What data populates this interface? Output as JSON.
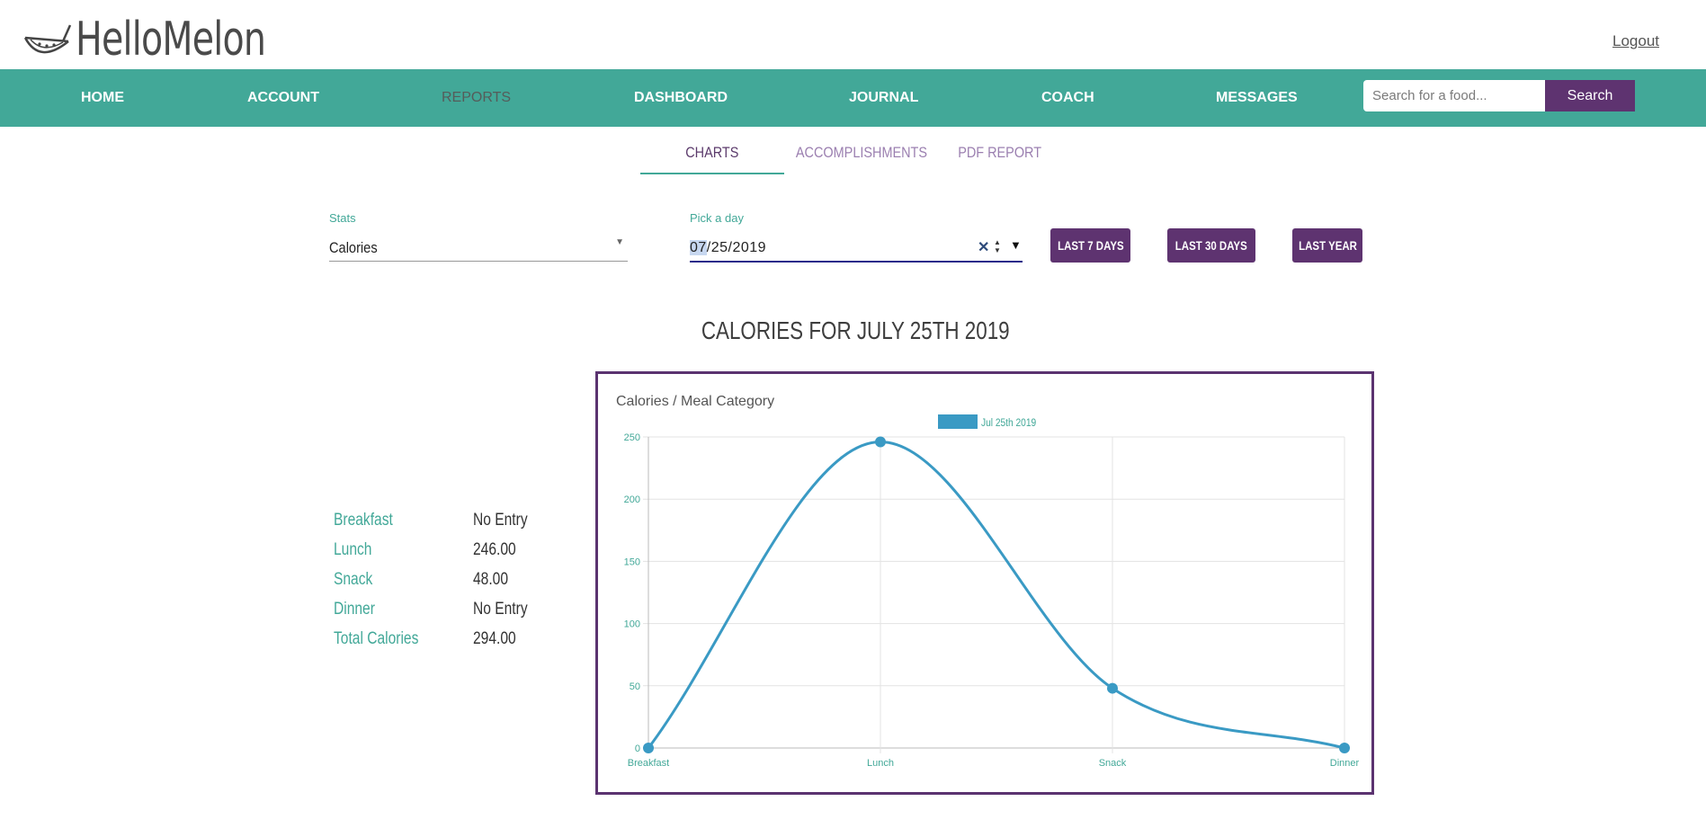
{
  "app": {
    "brand": "HelloMelon",
    "logout_label": "Logout"
  },
  "nav": {
    "items": [
      {
        "label": "HOME",
        "active": false
      },
      {
        "label": "ACCOUNT",
        "active": false
      },
      {
        "label": "REPORTS",
        "active": true
      },
      {
        "label": "DASHBOARD",
        "active": false
      },
      {
        "label": "JOURNAL",
        "active": false
      },
      {
        "label": "COACH",
        "active": false
      },
      {
        "label": "MESSAGES",
        "active": false
      }
    ],
    "search_placeholder": "Search for a food...",
    "search_label": "Search"
  },
  "tabs": [
    {
      "label": "CHARTS",
      "active": true
    },
    {
      "label": "ACCOMPLISHMENTS",
      "active": false
    },
    {
      "label": "PDF REPORT",
      "active": false
    }
  ],
  "filters": {
    "stats_label": "Stats",
    "stats_value": "Calories",
    "date_label": "Pick a day",
    "date_month": "07",
    "date_rest": "/25/2019",
    "buttons": [
      "LAST 7 DAYS",
      "LAST 30 DAYS",
      "LAST YEAR"
    ]
  },
  "page_title": "CALORIES FOR JULY 25TH 2019",
  "stats": [
    {
      "label": "Breakfast",
      "value": "No Entry"
    },
    {
      "label": "Lunch",
      "value": "246.00"
    },
    {
      "label": "Snack",
      "value": "48.00"
    },
    {
      "label": "Dinner",
      "value": "No Entry"
    },
    {
      "label": "Total Calories",
      "value": "294.00"
    }
  ],
  "colors": {
    "teal": "#42a898",
    "purple": "#5e3370",
    "series": "#3a9ac4"
  },
  "chart_data": {
    "type": "line",
    "title": "Calories / Meal Category",
    "categories": [
      "Breakfast",
      "Lunch",
      "Snack",
      "Dinner"
    ],
    "series": [
      {
        "name": "Jul 25th 2019",
        "values": [
          0,
          246,
          48,
          0
        ]
      }
    ],
    "ylim": [
      0,
      250
    ],
    "yticks": [
      0,
      50,
      100,
      150,
      200,
      250
    ],
    "grid": true,
    "legend": "top"
  }
}
